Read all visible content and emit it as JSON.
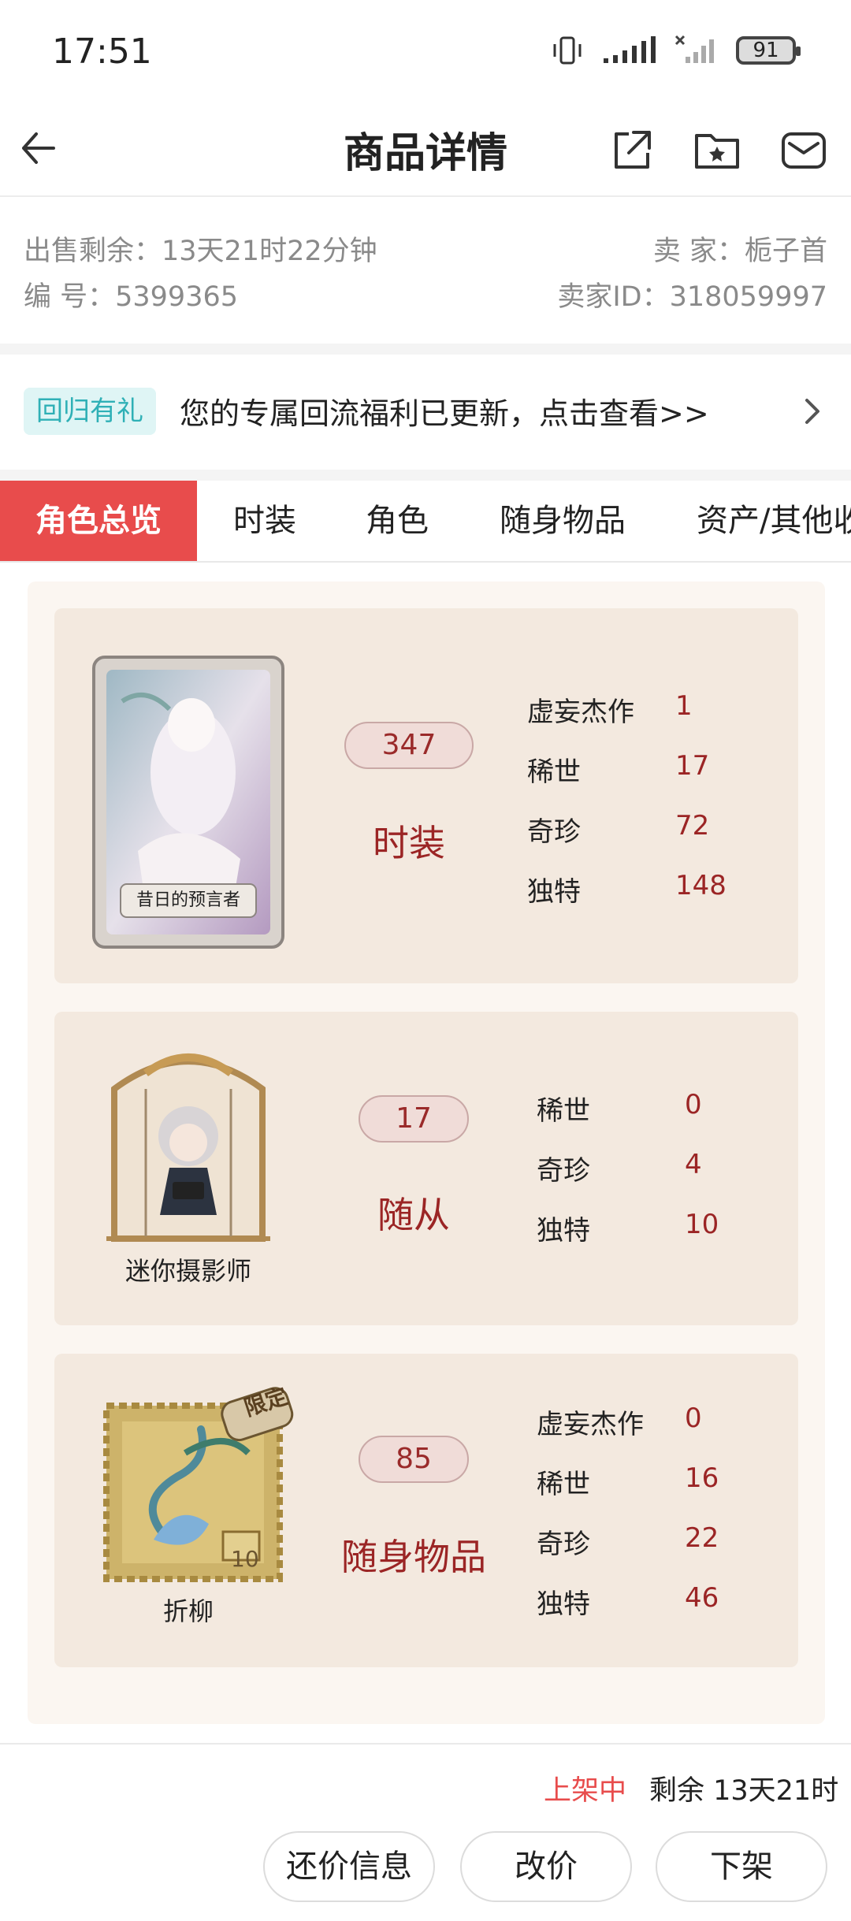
{
  "status_bar": {
    "time": "17:51",
    "battery": "91",
    "icons": [
      "vibrate-icon",
      "signal-icon",
      "signal-off-icon",
      "battery-icon"
    ]
  },
  "header": {
    "title": "商品详情",
    "icons": [
      "back-arrow-icon",
      "share-icon",
      "favorite-folder-icon",
      "message-icon"
    ]
  },
  "info": {
    "remaining": "出售剩余：13天21时22分钟",
    "seller": "卖 家：栀子首",
    "number": "编 号：5399365",
    "seller_id": "卖家ID：318059997"
  },
  "banner": {
    "badge": "回归有礼",
    "text": "您的专属回流福利已更新，点击查看>>"
  },
  "tabs": [
    "角色总览",
    "时装",
    "角色",
    "随身物品",
    "资产/其他收"
  ],
  "cards": [
    {
      "thumb_label": "昔日的预言者",
      "count": "347",
      "category": "时装",
      "stats": [
        {
          "name": "虚妄杰作",
          "value": "1"
        },
        {
          "name": "稀世",
          "value": "17"
        },
        {
          "name": "奇珍",
          "value": "72"
        },
        {
          "name": "独特",
          "value": "148"
        }
      ]
    },
    {
      "thumb_label": "迷你摄影师",
      "count": "17",
      "category": "随从",
      "stats": [
        {
          "name": "稀世",
          "value": "0"
        },
        {
          "name": "奇珍",
          "value": "4"
        },
        {
          "name": "独特",
          "value": "10"
        }
      ]
    },
    {
      "thumb_label": "折柳",
      "thumb_tag": "限定",
      "stamp_number": "10",
      "count": "85",
      "category": "随身物品",
      "stats": [
        {
          "name": "虚妄杰作",
          "value": "0"
        },
        {
          "name": "稀世",
          "value": "16"
        },
        {
          "name": "奇珍",
          "value": "22"
        },
        {
          "name": "独特",
          "value": "46"
        }
      ]
    }
  ],
  "footer": {
    "status": "上架中",
    "remaining": "剩余 13天21时",
    "buttons": [
      "还价信息",
      "改价",
      "下架"
    ]
  },
  "colors": {
    "accent": "#e84c4c",
    "dark_red": "#9b2525",
    "card_bg": "#f3e9df",
    "panel_bg": "#fbf6f1",
    "teal": "#2fb0b6"
  }
}
